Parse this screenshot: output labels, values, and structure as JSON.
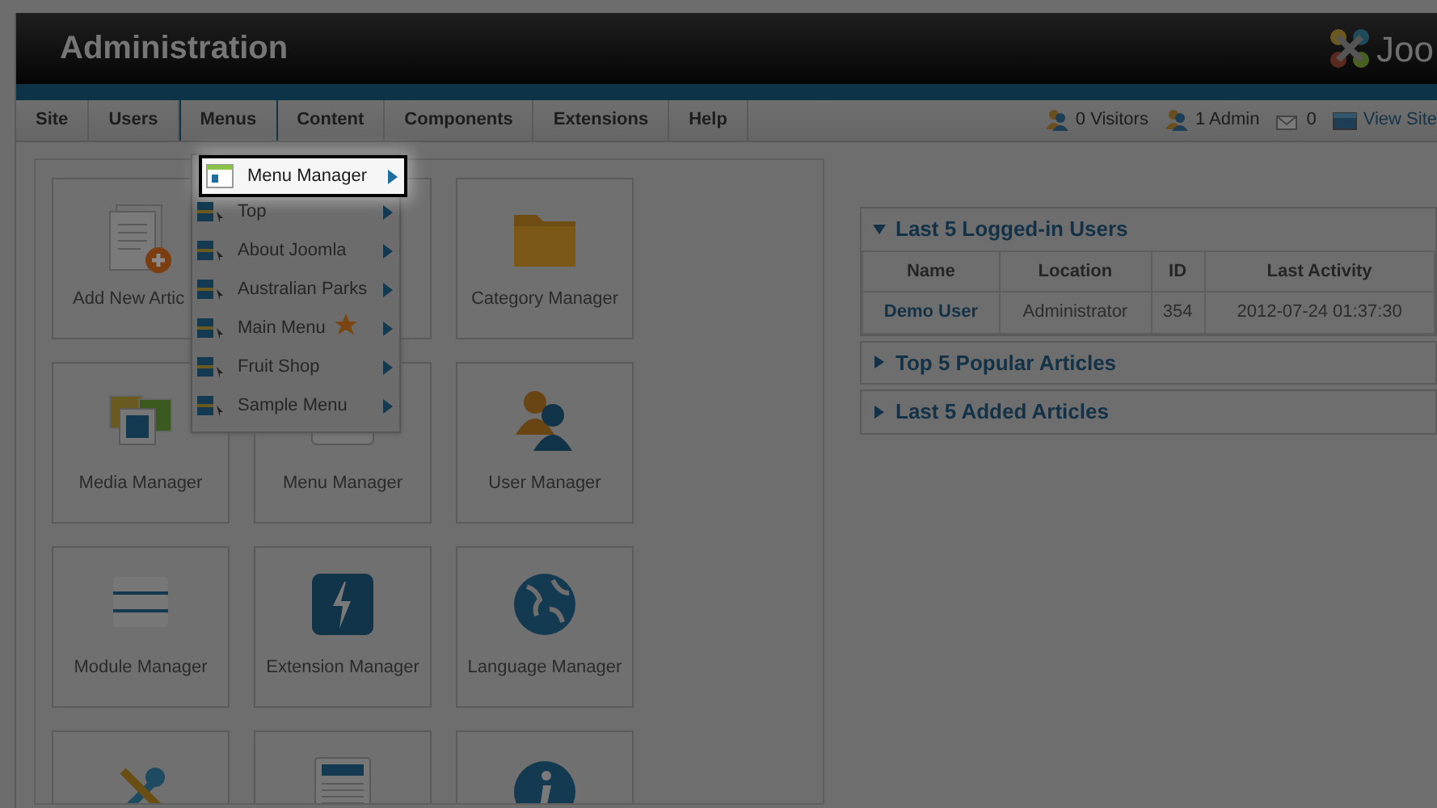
{
  "header": {
    "title": "Administration",
    "logo_text": "Joo"
  },
  "menu_bar": {
    "items": [
      {
        "label": "Site",
        "selected": false
      },
      {
        "label": "Users",
        "selected": false
      },
      {
        "label": "Menus",
        "selected": true
      },
      {
        "label": "Content",
        "selected": false
      },
      {
        "label": "Components",
        "selected": false
      },
      {
        "label": "Extensions",
        "selected": false
      },
      {
        "label": "Help",
        "selected": false
      }
    ],
    "status": [
      {
        "kind": "visitors",
        "text": "0 Visitors"
      },
      {
        "kind": "admin",
        "text": "1 Admin"
      },
      {
        "kind": "messages",
        "text": "0"
      },
      {
        "kind": "view",
        "text": "View Site"
      }
    ]
  },
  "dropdown": {
    "items": [
      {
        "label": "Menu Manager",
        "highlighted": true,
        "starred": false
      },
      {
        "label": "Top",
        "highlighted": false,
        "starred": false
      },
      {
        "label": "About Joomla",
        "highlighted": false,
        "starred": false
      },
      {
        "label": "Australian Parks",
        "highlighted": false,
        "starred": false
      },
      {
        "label": "Main Menu",
        "highlighted": false,
        "starred": true
      },
      {
        "label": "Fruit Shop",
        "highlighted": false,
        "starred": false
      },
      {
        "label": "Sample Menu",
        "highlighted": false,
        "starred": false
      }
    ]
  },
  "quick_icons": [
    {
      "kind": "article",
      "label": "Add New Artic"
    },
    {
      "kind": "hidden"
    },
    {
      "kind": "folder",
      "label": "Category Manager"
    },
    {
      "kind": "media",
      "label": "Media Manager"
    },
    {
      "kind": "menu",
      "label": "Menu Manager"
    },
    {
      "kind": "user",
      "label": "User Manager"
    },
    {
      "kind": "module",
      "label": "Module Manager"
    },
    {
      "kind": "extension",
      "label": "Extension Manager"
    },
    {
      "kind": "language",
      "label": "Language Manager"
    },
    {
      "kind": "tools"
    },
    {
      "kind": "template"
    },
    {
      "kind": "info"
    }
  ],
  "modules": [
    {
      "title": "Last 5 Logged-in Users",
      "expanded": true,
      "table": {
        "columns": [
          "Name",
          "Location",
          "ID",
          "Last Activity"
        ],
        "rows": [
          [
            "Demo User",
            "Administrator",
            "354",
            "2012-07-24 01:37:30"
          ]
        ]
      }
    },
    {
      "title": "Top 5 Popular Articles",
      "expanded": false
    },
    {
      "title": "Last 5 Added Articles",
      "expanded": false
    }
  ]
}
